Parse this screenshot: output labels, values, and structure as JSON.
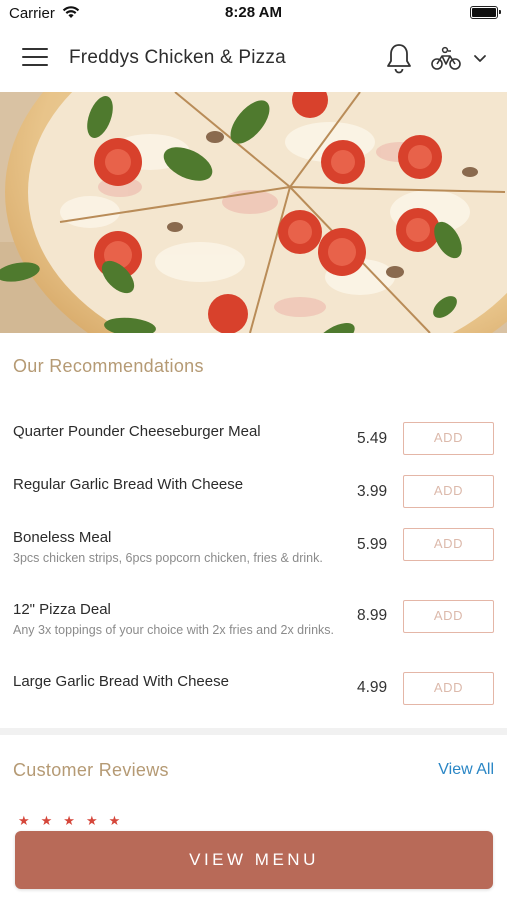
{
  "status_bar": {
    "carrier": "Carrier",
    "time": "8:28 AM"
  },
  "header": {
    "title": "Freddys Chicken & Pizza",
    "icons": [
      "menu-icon",
      "bell-icon",
      "bike-icon",
      "chevron-down-icon"
    ]
  },
  "hero": {
    "icon": "pizza-photo"
  },
  "recommendations": {
    "title": "Our Recommendations",
    "items": [
      {
        "name": "Quarter Pounder Cheeseburger Meal",
        "description": "",
        "price": "5.49",
        "add_label": "ADD"
      },
      {
        "name": "Regular Garlic Bread With Cheese",
        "description": "",
        "price": "3.99",
        "add_label": "ADD"
      },
      {
        "name": "Boneless Meal",
        "description": "3pcs chicken strips, 6pcs popcorn chicken, fries & drink.",
        "price": "5.99",
        "add_label": "ADD"
      },
      {
        "name": "12\" Pizza Deal",
        "description": "Any 3x toppings of your choice with 2x fries and 2x drinks.",
        "price": "8.99",
        "add_label": "ADD"
      },
      {
        "name": "Large Garlic Bread With Cheese",
        "description": "",
        "price": "4.99",
        "add_label": "ADD"
      }
    ]
  },
  "reviews": {
    "title": "Customer Reviews",
    "view_all": "View All",
    "stars": "★★★★★"
  },
  "cta": {
    "label": "VIEW MENU"
  },
  "colors": {
    "accent": "#b86a58",
    "section_title": "#b59a74",
    "link": "#2a86c5",
    "add_border": "#e4b6a7"
  }
}
